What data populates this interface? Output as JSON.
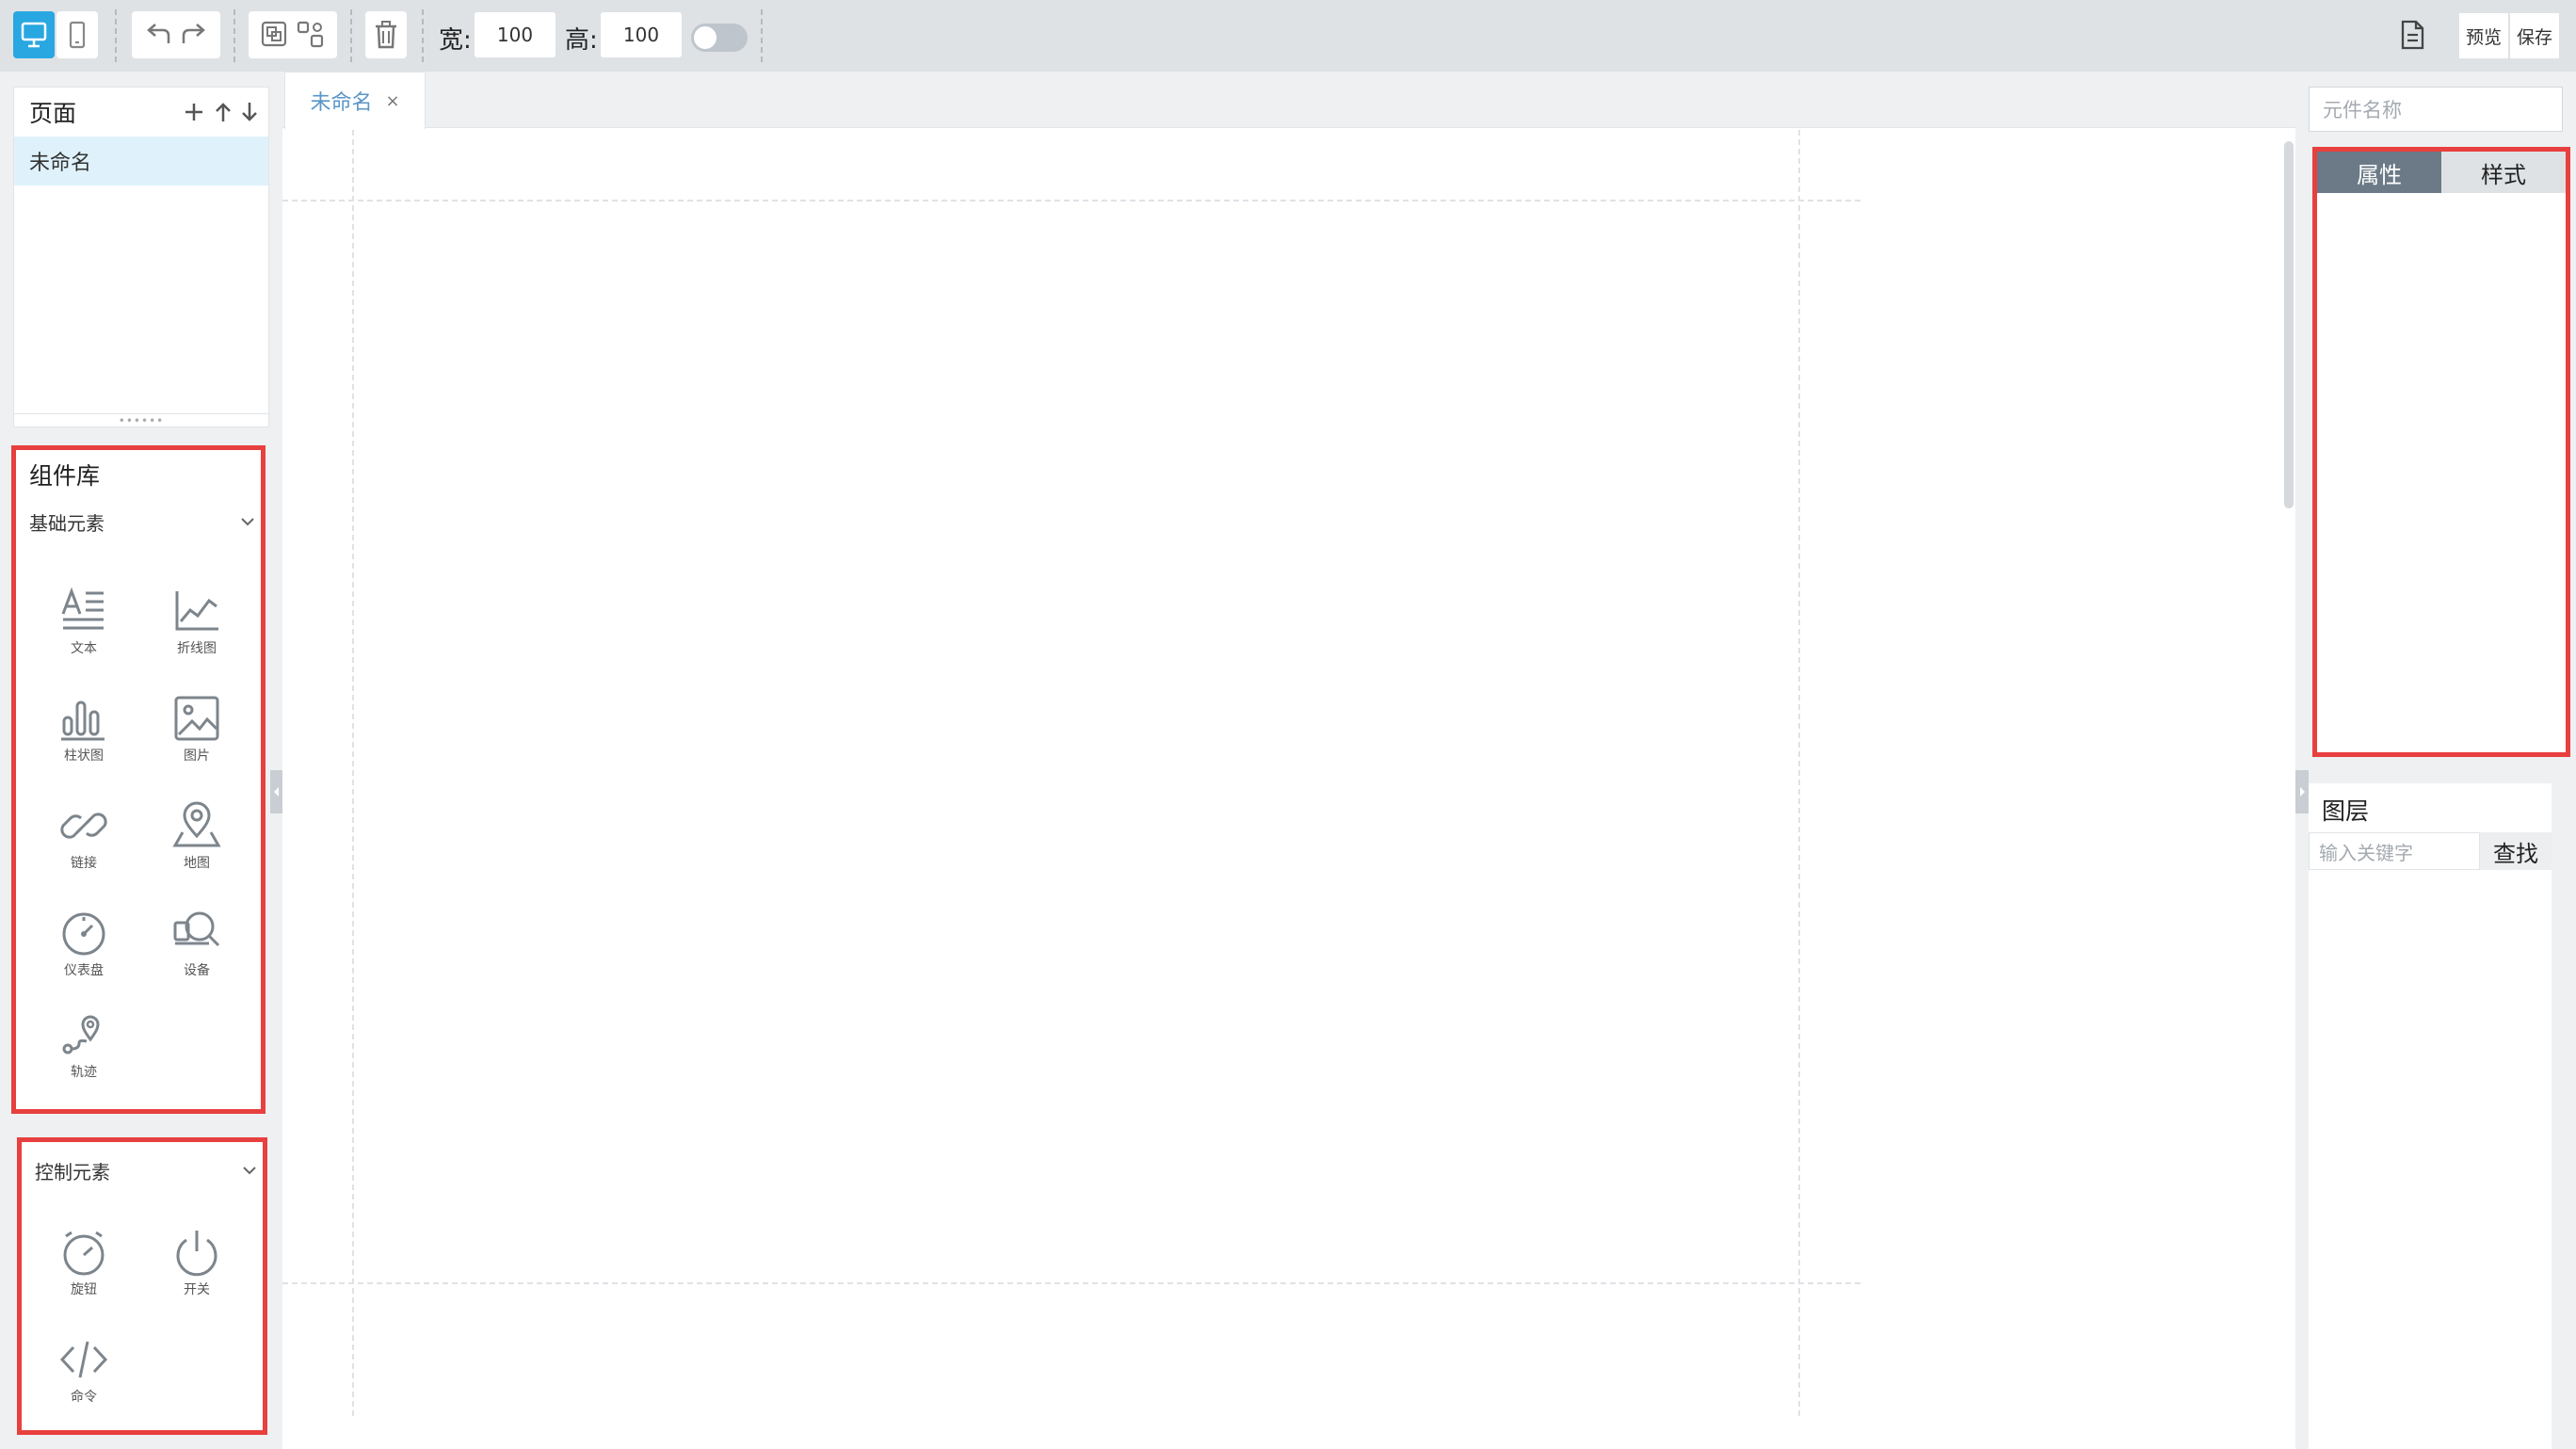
{
  "toolbar": {
    "width_label": "宽:",
    "width_value": "100",
    "height_label": "高:",
    "height_value": "100",
    "preview": "预览",
    "save": "保存"
  },
  "pages": {
    "title": "页面",
    "items": [
      {
        "label": "未命名"
      }
    ]
  },
  "library": {
    "title": "组件库",
    "basic": {
      "label": "基础元素",
      "items": [
        {
          "label": "文本",
          "icon": "text-icon"
        },
        {
          "label": "折线图",
          "icon": "line-chart-icon"
        },
        {
          "label": "柱状图",
          "icon": "bar-chart-icon"
        },
        {
          "label": "图片",
          "icon": "image-icon"
        },
        {
          "label": "链接",
          "icon": "link-icon"
        },
        {
          "label": "地图",
          "icon": "map-icon"
        },
        {
          "label": "仪表盘",
          "icon": "dashboard-icon"
        },
        {
          "label": "设备",
          "icon": "device-icon"
        },
        {
          "label": "轨迹",
          "icon": "track-icon"
        }
      ]
    },
    "control": {
      "label": "控制元素",
      "items": [
        {
          "label": "旋钮",
          "icon": "knob-icon"
        },
        {
          "label": "开关",
          "icon": "power-icon"
        },
        {
          "label": "命令",
          "icon": "code-icon"
        }
      ]
    }
  },
  "canvas": {
    "tab_label": "未命名",
    "tab_close": "×"
  },
  "right": {
    "component_name_placeholder": "元件名称",
    "tabs": [
      {
        "label": "属性"
      },
      {
        "label": "样式"
      }
    ],
    "layers_title": "图层",
    "layers_search_placeholder": "输入关键字",
    "layers_search_button": "查找"
  },
  "colors": {
    "accent": "#29a7e1",
    "highlight_border": "#e83f3f",
    "active_tab": "#6b7a86",
    "selected_page": "#dff2fb"
  }
}
